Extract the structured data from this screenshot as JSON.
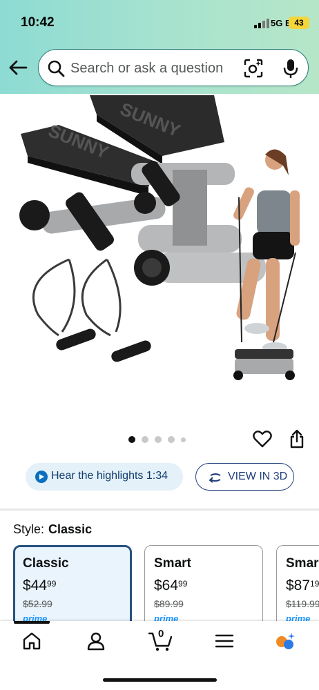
{
  "status_bar": {
    "time": "10:42",
    "network": "5G E",
    "battery": "43"
  },
  "search": {
    "placeholder": "Search or ask a question"
  },
  "carousel": {
    "image_count": 5,
    "active_index": 0
  },
  "highlights": {
    "label": "Hear the highlights 1:34"
  },
  "view_3d": {
    "label": "VIEW IN 3D"
  },
  "style_selector": {
    "label": "Style:",
    "selected": "Classic",
    "options": [
      {
        "name": "Classic",
        "price_whole": "$44",
        "price_cents": "99",
        "list_price": "$52.99",
        "badge": "prime"
      },
      {
        "name": "Smart",
        "price_whole": "$64",
        "price_cents": "99",
        "list_price": "$89.99",
        "badge": "prime"
      },
      {
        "name": "Smar",
        "price_whole": "$87",
        "price_cents": "19",
        "list_price": "$119.99",
        "badge": "prime"
      }
    ]
  },
  "product_image": {
    "brand_text": "SUNNY"
  },
  "tab_bar": {
    "items": [
      "home-icon",
      "account-icon",
      "cart-icon",
      "menu-icon",
      "rufus-icon"
    ],
    "cart_count": "0"
  },
  "colors": {
    "header_gradient_start": "#8ddbd3",
    "header_gradient_end": "#b6e6c8",
    "selected_card_border": "#27527e",
    "selected_card_bg": "#eaf4fd",
    "prime_blue": "#1a98ff"
  }
}
